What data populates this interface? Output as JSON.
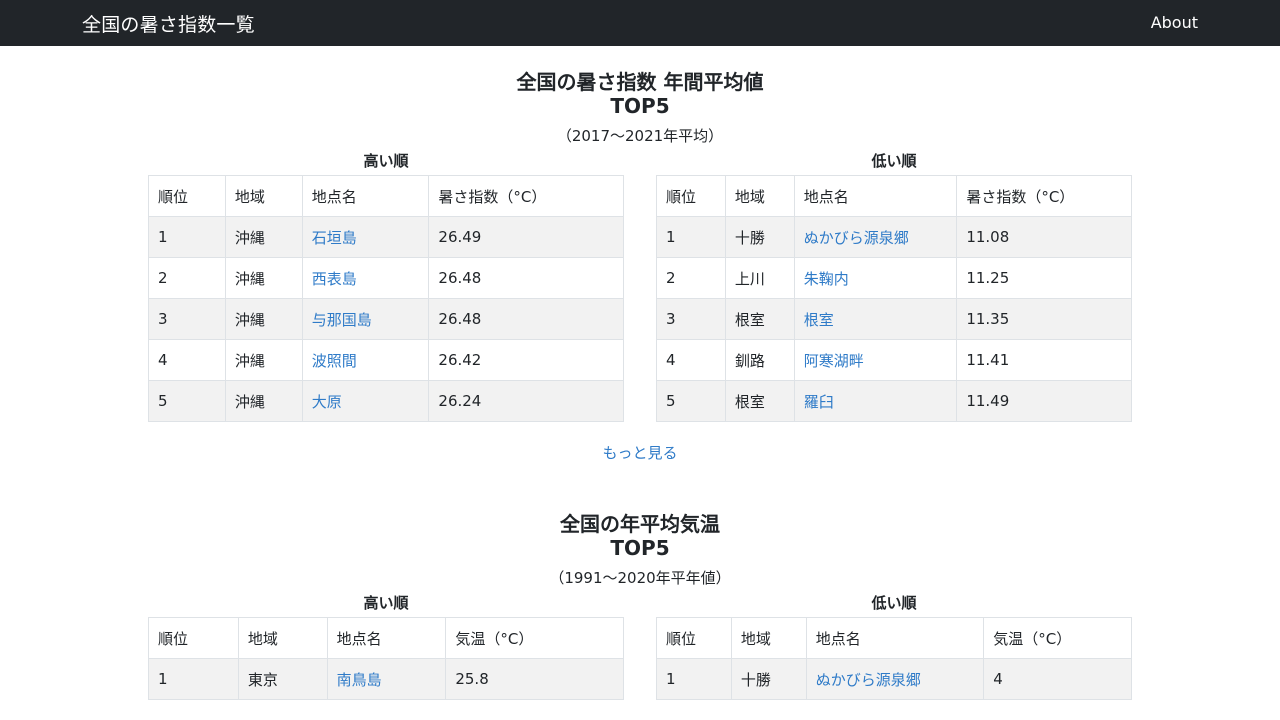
{
  "nav": {
    "brand": "全国の暑さ指数一覧",
    "about": "About"
  },
  "wbgt": {
    "title": "全国の暑さ指数 年間平均値",
    "subtitle": "TOP5",
    "period": "（2017～2021年平均）",
    "high": {
      "heading": "高い順",
      "columns": [
        "順位",
        "地域",
        "地点名",
        "暑さ指数（°C）"
      ],
      "rows": [
        [
          "1",
          "沖縄",
          "石垣島",
          "26.49"
        ],
        [
          "2",
          "沖縄",
          "西表島",
          "26.48"
        ],
        [
          "3",
          "沖縄",
          "与那国島",
          "26.48"
        ],
        [
          "4",
          "沖縄",
          "波照間",
          "26.42"
        ],
        [
          "5",
          "沖縄",
          "大原",
          "26.24"
        ]
      ]
    },
    "low": {
      "heading": "低い順",
      "columns": [
        "順位",
        "地域",
        "地点名",
        "暑さ指数（°C）"
      ],
      "rows": [
        [
          "1",
          "十勝",
          "ぬかびら源泉郷",
          "11.08"
        ],
        [
          "2",
          "上川",
          "朱鞠内",
          "11.25"
        ],
        [
          "3",
          "根室",
          "根室",
          "11.35"
        ],
        [
          "4",
          "釧路",
          "阿寒湖畔",
          "11.41"
        ],
        [
          "5",
          "根室",
          "羅臼",
          "11.49"
        ]
      ]
    },
    "more": "もっと見る"
  },
  "temp": {
    "title": "全国の年平均気温",
    "subtitle": "TOP5",
    "period": "（1991～2020年平年値）",
    "high": {
      "heading": "高い順",
      "columns": [
        "順位",
        "地域",
        "地点名",
        "気温（°C）"
      ],
      "rows": [
        [
          "1",
          "東京",
          "南鳥島",
          "25.8"
        ]
      ]
    },
    "low": {
      "heading": "低い順",
      "columns": [
        "順位",
        "地域",
        "地点名",
        "気温（°C）"
      ],
      "rows": [
        [
          "1",
          "十勝",
          "ぬかびら源泉郷",
          "4"
        ]
      ]
    }
  }
}
